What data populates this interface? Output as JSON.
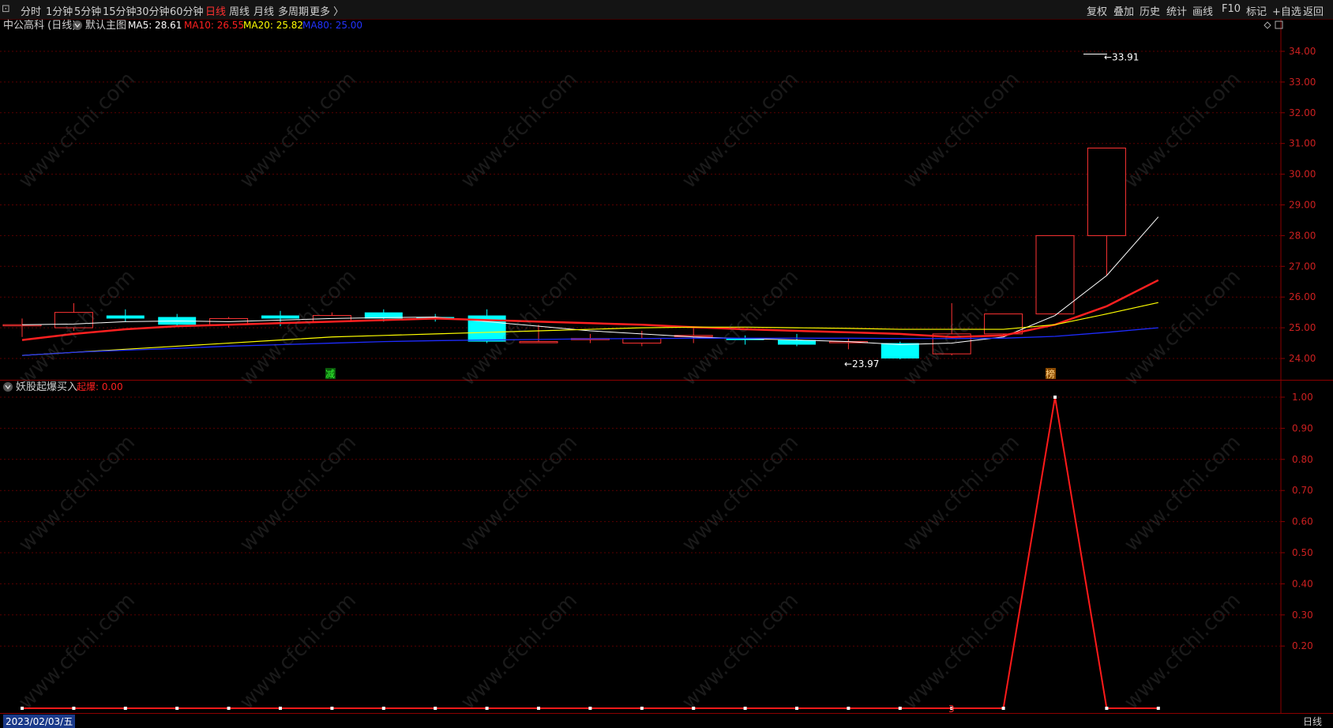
{
  "toolbar": {
    "left": [
      "分时",
      "1分钟",
      "5分钟",
      "15分钟",
      "30分钟",
      "60分钟",
      "日线",
      "周线",
      "月线",
      "多周期",
      "更多 〉"
    ],
    "active": "日线",
    "right": [
      "复权",
      "叠加",
      "历史",
      "统计",
      "画线",
      "F10",
      "标记",
      "+自选",
      "返回"
    ]
  },
  "main": {
    "title": "中公高科 (日线)",
    "template": "默认主图",
    "ma": [
      {
        "label": "MA5: 28.61",
        "color": "#ffffff"
      },
      {
        "label": "MA10: 26.55",
        "color": "#ff2020"
      },
      {
        "label": "MA20: 25.82",
        "color": "#ffff00"
      },
      {
        "label": "MA80: 25.00",
        "color": "#2233ff"
      }
    ],
    "high_label": "33.91",
    "low_label": "23.97",
    "axis_ticks": [
      "34.00",
      "33.00",
      "32.00",
      "31.00",
      "30.00",
      "29.00",
      "28.00",
      "27.00",
      "26.00",
      "25.00",
      "24.00"
    ],
    "marker_jian": "减",
    "marker_bang": "榜"
  },
  "sub": {
    "title": "妖股起爆买入",
    "value_label": "起爆: 0.00",
    "axis_ticks": [
      "1.00",
      "0.90",
      "0.80",
      "0.70",
      "0.60",
      "0.50",
      "0.40",
      "0.30",
      "0.20"
    ]
  },
  "status": {
    "date": "2023/02/03/五",
    "marker": "3",
    "period": "日线"
  },
  "watermark_text": "www.cfchi.com",
  "colors": {
    "up": "#ff3333",
    "down": "#00ffff",
    "ma5": "#ffffff",
    "ma10": "#ff2020",
    "ma20": "#ffff00",
    "ma80": "#1e2cff",
    "signal": "#ff1a1a"
  },
  "chart_data": [
    {
      "type": "candlestick",
      "ylim": [
        23.7,
        34.2
      ],
      "candles": [
        {
          "o": 25.1,
          "c": 25.1,
          "h": 25.3,
          "l": 24.7
        },
        {
          "o": 25.0,
          "c": 25.5,
          "h": 25.8,
          "l": 24.9
        },
        {
          "o": 25.4,
          "c": 25.3,
          "h": 25.6,
          "l": 25.2
        },
        {
          "o": 25.35,
          "c": 25.1,
          "h": 25.45,
          "l": 25.05
        },
        {
          "o": 25.1,
          "c": 25.3,
          "h": 25.35,
          "l": 25.0
        },
        {
          "o": 25.4,
          "c": 25.3,
          "h": 25.55,
          "l": 25.05
        },
        {
          "o": 25.2,
          "c": 25.4,
          "h": 25.5,
          "l": 25.2
        },
        {
          "o": 25.5,
          "c": 25.3,
          "h": 25.6,
          "l": 25.2
        },
        {
          "o": 25.35,
          "c": 25.3,
          "h": 25.45,
          "l": 25.2
        },
        {
          "o": 25.4,
          "c": 24.55,
          "h": 25.6,
          "l": 24.5
        },
        {
          "o": 24.55,
          "c": 24.55,
          "h": 25.1,
          "l": 24.5
        },
        {
          "o": 24.65,
          "c": 24.65,
          "h": 24.8,
          "l": 24.5
        },
        {
          "o": 24.5,
          "c": 24.65,
          "h": 24.9,
          "l": 24.4
        },
        {
          "o": 24.75,
          "c": 24.75,
          "h": 25.0,
          "l": 24.5
        },
        {
          "o": 24.65,
          "c": 24.6,
          "h": 24.75,
          "l": 24.45
        },
        {
          "o": 24.6,
          "c": 24.45,
          "h": 24.8,
          "l": 24.4
        },
        {
          "o": 24.55,
          "c": 24.55,
          "h": 24.65,
          "l": 24.3
        },
        {
          "o": 24.5,
          "c": 24.0,
          "h": 24.55,
          "l": 23.97
        },
        {
          "o": 24.15,
          "c": 24.8,
          "h": 25.8,
          "l": 24.1
        },
        {
          "o": 24.8,
          "c": 25.45,
          "h": 25.45,
          "l": 24.75
        },
        {
          "o": 25.45,
          "c": 28.0,
          "h": 28.0,
          "l": 25.45
        },
        {
          "o": 28.0,
          "c": 30.85,
          "h": 30.85,
          "l": 26.7
        }
      ],
      "ma_series": [
        {
          "name": "MA5",
          "values": [
            25.1,
            25.12,
            25.2,
            25.22,
            25.2,
            25.25,
            25.3,
            25.33,
            25.35,
            25.2,
            25.05,
            24.9,
            24.8,
            24.7,
            24.65,
            24.6,
            24.55,
            24.45,
            24.5,
            24.7,
            25.4,
            26.7,
            28.61
          ]
        },
        {
          "name": "MA10",
          "values": [
            24.6,
            24.8,
            24.95,
            25.05,
            25.1,
            25.15,
            25.2,
            25.25,
            25.3,
            25.25,
            25.2,
            25.15,
            25.1,
            25.02,
            24.95,
            24.9,
            24.85,
            24.8,
            24.7,
            24.75,
            25.1,
            25.7,
            26.55
          ]
        },
        {
          "name": "MA20",
          "values": [
            24.1,
            24.2,
            24.3,
            24.4,
            24.5,
            24.6,
            24.7,
            24.75,
            24.8,
            24.85,
            24.9,
            24.95,
            25.0,
            25.02,
            25.02,
            25.0,
            24.98,
            24.95,
            24.95,
            24.95,
            25.1,
            25.45,
            25.82
          ]
        },
        {
          "name": "MA80",
          "values": [
            24.1,
            24.2,
            24.27,
            24.33,
            24.4,
            24.45,
            24.5,
            24.55,
            24.58,
            24.6,
            24.62,
            24.64,
            24.65,
            24.66,
            24.66,
            24.66,
            24.66,
            24.65,
            24.65,
            24.66,
            24.72,
            24.85,
            25.0
          ]
        }
      ]
    },
    {
      "type": "line",
      "ylim": [
        0,
        1.05
      ],
      "series": [
        {
          "name": "起爆",
          "values": [
            0,
            0,
            0,
            0,
            0,
            0,
            0,
            0,
            0,
            0,
            0,
            0,
            0,
            0,
            0,
            0,
            0,
            0,
            0,
            0,
            1.0,
            0,
            0
          ]
        }
      ]
    }
  ]
}
